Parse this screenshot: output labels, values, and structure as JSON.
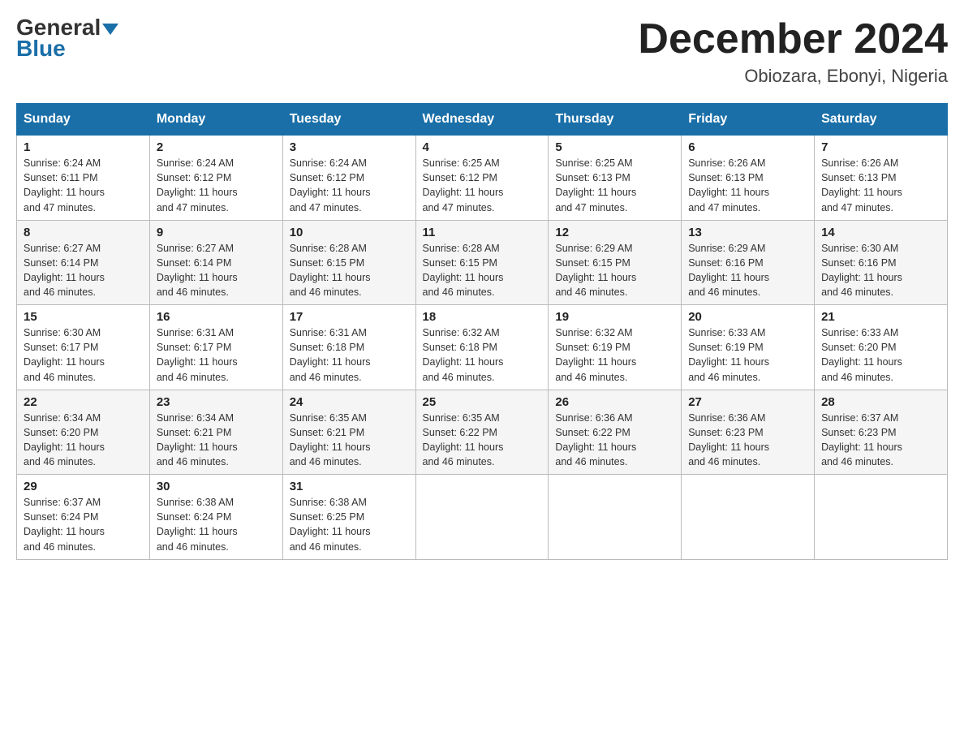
{
  "header": {
    "logo_top": "General",
    "logo_bottom": "Blue",
    "month_title": "December 2024",
    "location": "Obiozara, Ebonyi, Nigeria"
  },
  "weekdays": [
    "Sunday",
    "Monday",
    "Tuesday",
    "Wednesday",
    "Thursday",
    "Friday",
    "Saturday"
  ],
  "weeks": [
    [
      {
        "day": "1",
        "sunrise": "6:24 AM",
        "sunset": "6:11 PM",
        "daylight": "11 hours and 47 minutes."
      },
      {
        "day": "2",
        "sunrise": "6:24 AM",
        "sunset": "6:12 PM",
        "daylight": "11 hours and 47 minutes."
      },
      {
        "day": "3",
        "sunrise": "6:24 AM",
        "sunset": "6:12 PM",
        "daylight": "11 hours and 47 minutes."
      },
      {
        "day": "4",
        "sunrise": "6:25 AM",
        "sunset": "6:12 PM",
        "daylight": "11 hours and 47 minutes."
      },
      {
        "day": "5",
        "sunrise": "6:25 AM",
        "sunset": "6:13 PM",
        "daylight": "11 hours and 47 minutes."
      },
      {
        "day": "6",
        "sunrise": "6:26 AM",
        "sunset": "6:13 PM",
        "daylight": "11 hours and 47 minutes."
      },
      {
        "day": "7",
        "sunrise": "6:26 AM",
        "sunset": "6:13 PM",
        "daylight": "11 hours and 47 minutes."
      }
    ],
    [
      {
        "day": "8",
        "sunrise": "6:27 AM",
        "sunset": "6:14 PM",
        "daylight": "11 hours and 46 minutes."
      },
      {
        "day": "9",
        "sunrise": "6:27 AM",
        "sunset": "6:14 PM",
        "daylight": "11 hours and 46 minutes."
      },
      {
        "day": "10",
        "sunrise": "6:28 AM",
        "sunset": "6:15 PM",
        "daylight": "11 hours and 46 minutes."
      },
      {
        "day": "11",
        "sunrise": "6:28 AM",
        "sunset": "6:15 PM",
        "daylight": "11 hours and 46 minutes."
      },
      {
        "day": "12",
        "sunrise": "6:29 AM",
        "sunset": "6:15 PM",
        "daylight": "11 hours and 46 minutes."
      },
      {
        "day": "13",
        "sunrise": "6:29 AM",
        "sunset": "6:16 PM",
        "daylight": "11 hours and 46 minutes."
      },
      {
        "day": "14",
        "sunrise": "6:30 AM",
        "sunset": "6:16 PM",
        "daylight": "11 hours and 46 minutes."
      }
    ],
    [
      {
        "day": "15",
        "sunrise": "6:30 AM",
        "sunset": "6:17 PM",
        "daylight": "11 hours and 46 minutes."
      },
      {
        "day": "16",
        "sunrise": "6:31 AM",
        "sunset": "6:17 PM",
        "daylight": "11 hours and 46 minutes."
      },
      {
        "day": "17",
        "sunrise": "6:31 AM",
        "sunset": "6:18 PM",
        "daylight": "11 hours and 46 minutes."
      },
      {
        "day": "18",
        "sunrise": "6:32 AM",
        "sunset": "6:18 PM",
        "daylight": "11 hours and 46 minutes."
      },
      {
        "day": "19",
        "sunrise": "6:32 AM",
        "sunset": "6:19 PM",
        "daylight": "11 hours and 46 minutes."
      },
      {
        "day": "20",
        "sunrise": "6:33 AM",
        "sunset": "6:19 PM",
        "daylight": "11 hours and 46 minutes."
      },
      {
        "day": "21",
        "sunrise": "6:33 AM",
        "sunset": "6:20 PM",
        "daylight": "11 hours and 46 minutes."
      }
    ],
    [
      {
        "day": "22",
        "sunrise": "6:34 AM",
        "sunset": "6:20 PM",
        "daylight": "11 hours and 46 minutes."
      },
      {
        "day": "23",
        "sunrise": "6:34 AM",
        "sunset": "6:21 PM",
        "daylight": "11 hours and 46 minutes."
      },
      {
        "day": "24",
        "sunrise": "6:35 AM",
        "sunset": "6:21 PM",
        "daylight": "11 hours and 46 minutes."
      },
      {
        "day": "25",
        "sunrise": "6:35 AM",
        "sunset": "6:22 PM",
        "daylight": "11 hours and 46 minutes."
      },
      {
        "day": "26",
        "sunrise": "6:36 AM",
        "sunset": "6:22 PM",
        "daylight": "11 hours and 46 minutes."
      },
      {
        "day": "27",
        "sunrise": "6:36 AM",
        "sunset": "6:23 PM",
        "daylight": "11 hours and 46 minutes."
      },
      {
        "day": "28",
        "sunrise": "6:37 AM",
        "sunset": "6:23 PM",
        "daylight": "11 hours and 46 minutes."
      }
    ],
    [
      {
        "day": "29",
        "sunrise": "6:37 AM",
        "sunset": "6:24 PM",
        "daylight": "11 hours and 46 minutes."
      },
      {
        "day": "30",
        "sunrise": "6:38 AM",
        "sunset": "6:24 PM",
        "daylight": "11 hours and 46 minutes."
      },
      {
        "day": "31",
        "sunrise": "6:38 AM",
        "sunset": "6:25 PM",
        "daylight": "11 hours and 46 minutes."
      },
      null,
      null,
      null,
      null
    ]
  ],
  "labels": {
    "sunrise": "Sunrise:",
    "sunset": "Sunset:",
    "daylight": "Daylight:"
  }
}
